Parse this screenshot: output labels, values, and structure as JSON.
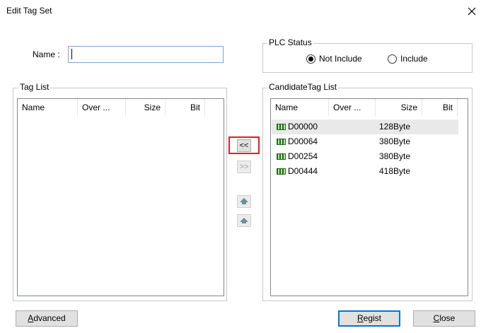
{
  "window": {
    "title": "Edit Tag Set"
  },
  "name_field": {
    "label": "Name :",
    "value": ""
  },
  "plc_status": {
    "title": "PLC Status",
    "options": [
      {
        "label": "Not Include",
        "checked": true
      },
      {
        "label": "Include",
        "checked": false
      }
    ]
  },
  "tag_list": {
    "title": "Tag List",
    "columns": [
      "Name",
      "Over ...",
      "Size",
      "Bit"
    ],
    "rows": []
  },
  "candidate_list": {
    "title": "CandidateTag List",
    "columns": [
      "Name",
      "Over ...",
      "Size",
      "Bit"
    ],
    "rows": [
      {
        "name": "D00000",
        "size": "128Byte",
        "selected": true
      },
      {
        "name": "D00064",
        "size": "380Byte",
        "selected": false
      },
      {
        "name": "D00254",
        "size": "380Byte",
        "selected": false
      },
      {
        "name": "D00444",
        "size": "418Byte",
        "selected": false
      }
    ]
  },
  "transfer": {
    "add_label": "<<",
    "remove_label": ">>"
  },
  "buttons": {
    "advanced_label": "Advanced",
    "advanced_mnemonic": "A",
    "advanced_rest": "dvanced",
    "regist_mnemonic": "R",
    "regist_rest": "egist",
    "close_mnemonic": "C",
    "close_rest": "lose"
  },
  "colors": {
    "highlight": "#e02020",
    "tag_icon": "#1f6b1a",
    "input_border": "#7aa7d6"
  }
}
